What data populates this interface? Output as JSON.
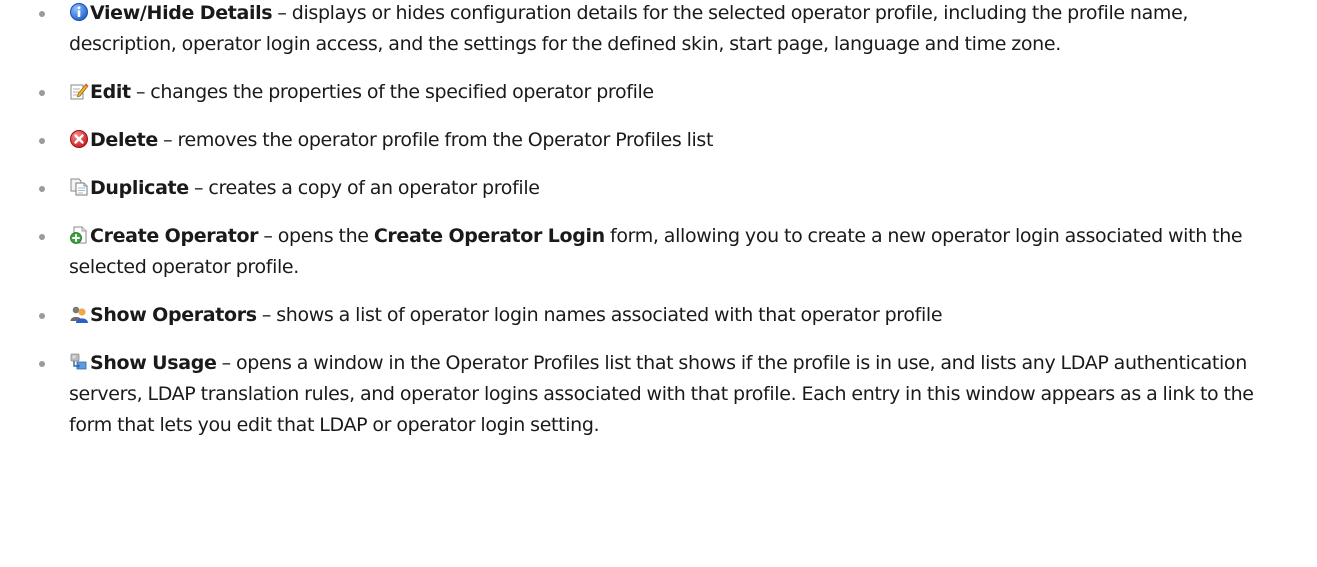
{
  "items": [
    {
      "icon": "info-icon",
      "term": "View/Hide Details",
      "text": " – displays or hides configuration details for the selected operator profile, including the profile name, description, operator login access, and the settings for the defined skin, start page, language and time zone."
    },
    {
      "icon": "edit-icon",
      "term": "Edit",
      "text": " – changes the properties of the specified operator profile"
    },
    {
      "icon": "delete-icon",
      "term": "Delete",
      "text": " – removes the operator profile from the Operator Profiles list"
    },
    {
      "icon": "duplicate-icon",
      "term": "Duplicate",
      "text": " – creates a copy of an operator profile"
    },
    {
      "icon": "create-operator-icon",
      "term": "Create Operator",
      "text_before": " – opens the ",
      "keyword": "Create Operator Login",
      "text_after": " form, allowing you to create a new operator login associated with the selected operator profile."
    },
    {
      "icon": "show-operators-icon",
      "term": "Show Operators",
      "text": " – shows a list of operator login names associated with that operator profile"
    },
    {
      "icon": "show-usage-icon",
      "term": "Show Usage",
      "text": " – opens a window in the Operator Profiles list that shows if the profile is in use, and lists any LDAP authentication servers, LDAP translation rules, and operator logins associated with that profile. Each entry in this window appears as a link to the form that lets you edit that LDAP or operator login setting."
    }
  ],
  "colors": {
    "info": "#2f6fd6",
    "delete": "#d9262b",
    "bullet": "#9a9a9a",
    "text": "#1a1a1a"
  }
}
